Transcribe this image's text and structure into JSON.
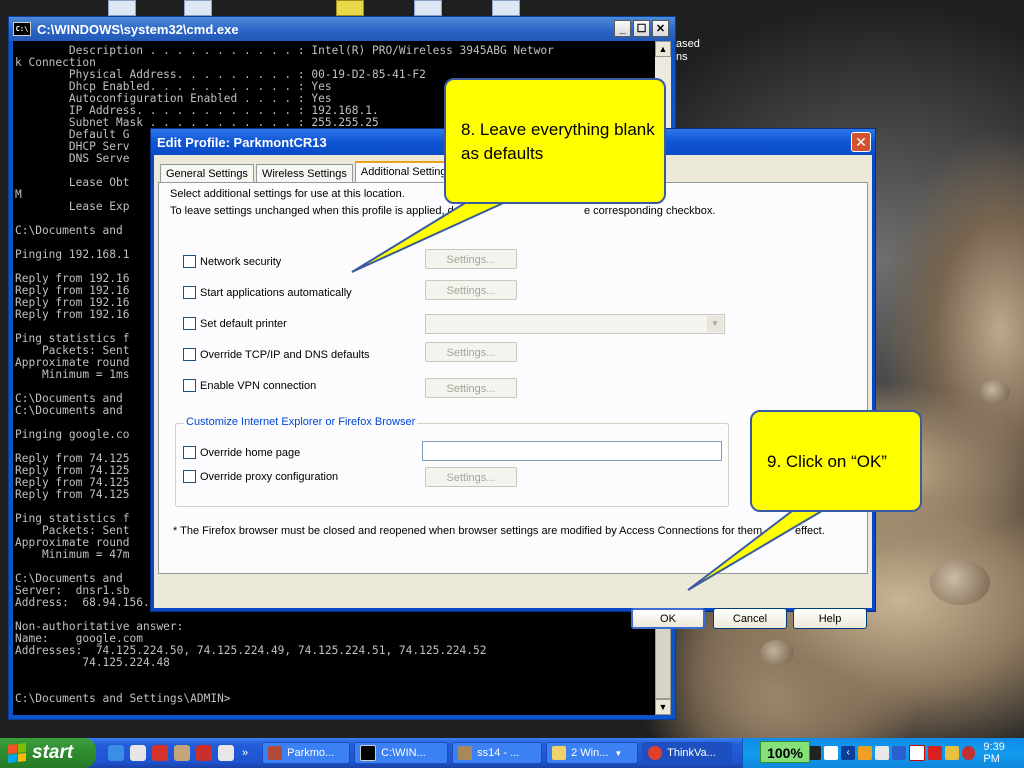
{
  "cmd_window": {
    "title": "C:\\WINDOWS\\system32\\cmd.exe",
    "console_text": "        Description . . . . . . . . . . . : Intel(R) PRO/Wireless 3945ABG Networ\nk Connection\n        Physical Address. . . . . . . . . : 00-19-D2-85-41-F2\n        Dhcp Enabled. . . . . . . . . . . : Yes\n        Autoconfiguration Enabled . . . . : Yes\n        IP Address. . . . . . . . . . . . : 192.168.1.\n        Subnet Mask . . . . . . . . . . . : 255.255.25\n        Default G\n        DHCP Serv\n        DNS Serve\n\n        Lease Obt\nM\n        Lease Exp\n\nC:\\Documents and\n\nPinging 192.168.1\n\nReply from 192.16\nReply from 192.16\nReply from 192.16\nReply from 192.16\n\nPing statistics f\n    Packets: Sent\nApproximate round\n    Minimum = 1ms\n\nC:\\Documents and\nC:\\Documents and\n\nPinging google.co\n\nReply from 74.125\nReply from 74.125\nReply from 74.125\nReply from 74.125\n\nPing statistics f\n    Packets: Sent\nApproximate round\n    Minimum = 47m\n\nC:\\Documents and\nServer:  dnsr1.sb\nAddress:  68.94.156.1\n\nNon-authoritative answer:\nName:    google.com\nAddresses:  74.125.224.50, 74.125.224.49, 74.125.224.51, 74.125.224.52\n          74.125.224.48\n\n\nC:\\Documents and Settings\\ADMIN>"
  },
  "desktop_text": {
    "behind_right_1": "ased",
    "behind_right_2": "ns"
  },
  "dialog": {
    "title": "Edit Profile: ParkmontCR13",
    "close_symbol": "✕",
    "tabs": [
      "General Settings",
      "Wireless Settings",
      "Additional Settings"
    ],
    "intro_line1": "Select additional settings for use at this location.",
    "intro_line2": "To leave settings unchanged when this profile is applied, do n",
    "intro_line2_tail": "e corresponding checkbox.",
    "options": {
      "network_security": "Network security",
      "start_apps": "Start applications automatically",
      "default_printer": "Set default printer",
      "override_tcpip": "Override TCP/IP and DNS defaults",
      "enable_vpn": "Enable VPN connection",
      "settings_label": "Settings..."
    },
    "browser_group": {
      "title": "Customize Internet Explorer or Firefox Browser",
      "home_page": "Override home page",
      "proxy": "Override proxy configuration"
    },
    "footnote": "* The Firefox browser must be closed and reopened when browser settings are modified by Access Connections for them",
    "footnote_tail": "effect.",
    "buttons": {
      "ok": "OK",
      "cancel": "Cancel",
      "help": "Help"
    }
  },
  "callouts": {
    "step8": "8. Leave everything blank as defaults",
    "step9": "9. Click on “OK”"
  },
  "taskbar": {
    "start_label": "start",
    "tasks": [
      "Parkmo...",
      "C:\\WIN...",
      "ss14 - ...",
      "2 Win...",
      "ThinkVa..."
    ],
    "zoom": "100%",
    "clock": "9:39 PM"
  },
  "colors": {
    "callout_fill": "#ffff00",
    "xp_blue": "#0a47c6",
    "start_green": "#2f8b2f"
  }
}
